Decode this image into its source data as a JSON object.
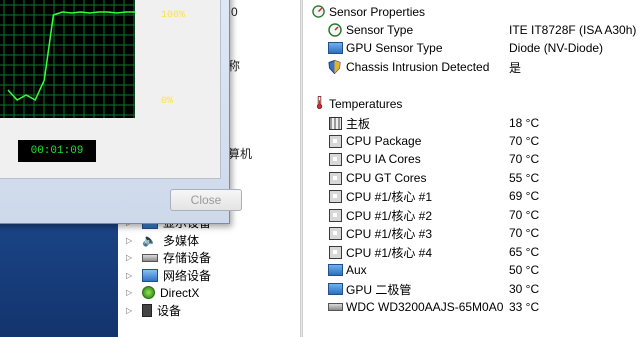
{
  "task_manager": {
    "graph_top_pct": "100%",
    "graph_bottom_pct": "0%",
    "cpu_usage_history": [
      0.2,
      0.1,
      0.15,
      0.1,
      0.3,
      0.95,
      0.98,
      0.97,
      0.98,
      0.97,
      0.98,
      0.98,
      0.97,
      0.98,
      0.98
    ],
    "uptime": "00:01:09",
    "close_label": "Close"
  },
  "background_window": {
    "fragments": [
      "0",
      "称",
      "算机"
    ]
  },
  "device_tree": [
    {
      "label": "显示设备",
      "icon": "monitor-icon"
    },
    {
      "label": "多媒体",
      "icon": "speaker-icon"
    },
    {
      "label": "存储设备",
      "icon": "storage-icon"
    },
    {
      "label": "网络设备",
      "icon": "network-icon"
    },
    {
      "label": "DirectX",
      "icon": "xbox-icon"
    },
    {
      "label": "设备",
      "icon": "device-icon"
    }
  ],
  "sensor_properties": {
    "header": "Sensor Properties",
    "rows": [
      {
        "label": "Sensor Type",
        "value": "ITE IT8728F  (ISA A30h)",
        "icon": "chip-sensor-icon"
      },
      {
        "label": "GPU Sensor Type",
        "value": "Diode  (NV-Diode)",
        "icon": "monitor-icon"
      },
      {
        "label": "Chassis Intrusion Detected",
        "value": "是",
        "icon": "shield-icon"
      }
    ]
  },
  "temperatures": {
    "header": "Temperatures",
    "rows": [
      {
        "label": "主板",
        "value": "18 °C",
        "icon": "motherboard-icon"
      },
      {
        "label": "CPU Package",
        "value": "70 °C",
        "icon": "cpu-icon"
      },
      {
        "label": "CPU IA Cores",
        "value": "70 °C",
        "icon": "cpu-icon"
      },
      {
        "label": "CPU GT Cores",
        "value": "55 °C",
        "icon": "cpu-icon"
      },
      {
        "label": "CPU #1/核心 #1",
        "value": "69 °C",
        "icon": "cpu-icon"
      },
      {
        "label": "CPU #1/核心 #2",
        "value": "70 °C",
        "icon": "cpu-icon"
      },
      {
        "label": "CPU #1/核心 #3",
        "value": "70 °C",
        "icon": "cpu-icon"
      },
      {
        "label": "CPU #1/核心 #4",
        "value": "65 °C",
        "icon": "cpu-icon"
      },
      {
        "label": "Aux",
        "value": "50 °C",
        "icon": "monitor-icon"
      },
      {
        "label": "GPU 二极管",
        "value": "30 °C",
        "icon": "monitor-icon"
      },
      {
        "label": "WDC WD3200AAJS-65M0A0",
        "value": "33 °C",
        "icon": "hard-drive-icon"
      }
    ]
  },
  "colors": {
    "graph_grid": "#0b7a2e",
    "graph_line": "#39ff3a",
    "percent_text": "#ffe23a",
    "timer_text": "#20e030"
  }
}
